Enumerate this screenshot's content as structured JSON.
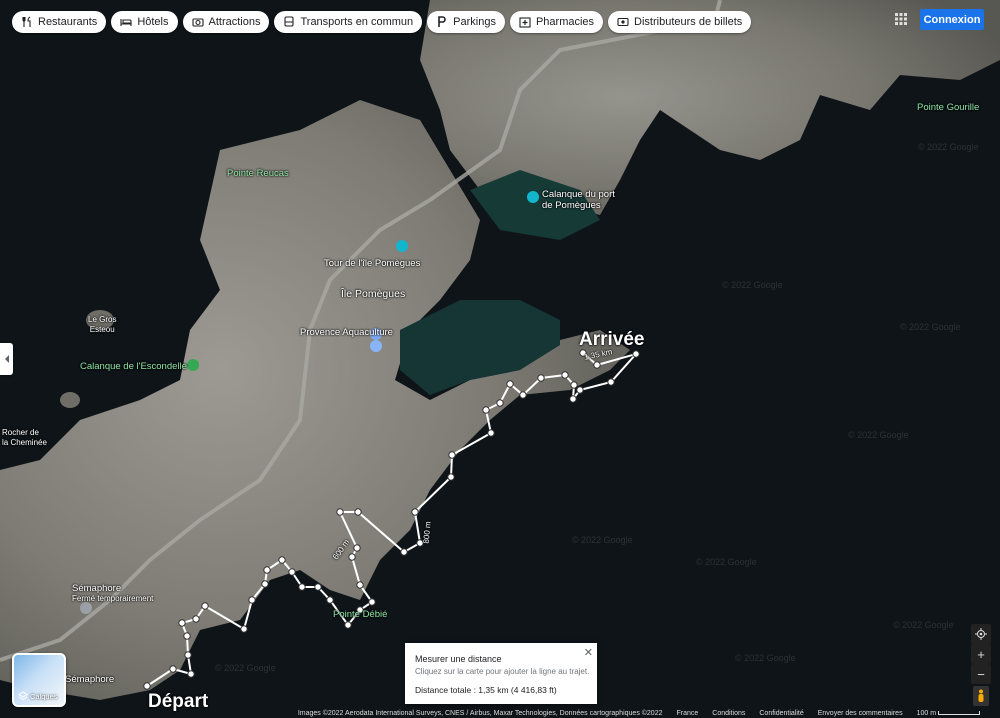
{
  "chips": [
    {
      "label": "Restaurants",
      "icon": "fork-knife-icon"
    },
    {
      "label": "Hôtels",
      "icon": "bed-icon"
    },
    {
      "label": "Attractions",
      "icon": "camera-icon"
    },
    {
      "label": "Transports en commun",
      "icon": "bus-icon"
    },
    {
      "label": "Parkings",
      "icon": "parking-icon"
    },
    {
      "label": "Pharmacies",
      "icon": "pharmacy-icon"
    },
    {
      "label": "Distributeurs de billets",
      "icon": "atm-icon"
    }
  ],
  "header": {
    "signin_label": "Connexion"
  },
  "labels": {
    "pointe_reucas": "Pointe Reucas",
    "calanque_port": "Calanque du port\nde Pomègues",
    "tour": "Tour de l'île Pomègues",
    "ile": "Île Pomègues",
    "aquaculture": "Provence Aquaculture",
    "gros_esteou": "Le Gros\nEsteou",
    "escondelle": "Calanque de l'Escondelle",
    "rocher": "Rocher de\nla Cheminée",
    "semaphore": "Sémaphore",
    "semaphore_sub": "Fermé temporairement",
    "semaphore2": "Sémaphore",
    "pointe_debie": "Pointe Débié",
    "pointe_gourille": "Pointe Gourille",
    "arrivee": "Arrivée",
    "depart": "Départ",
    "dist1": "1,35 km",
    "dist2": "600 m",
    "dist3": "800 m",
    "watermark": "© 2022 Google"
  },
  "measure": {
    "title": "Mesurer une distance",
    "hint": "Cliquez sur la carte pour ajouter la ligne au trajet.",
    "total": "Distance totale : 1,35 km (4 416,83 ft)"
  },
  "layers_label": "Calques",
  "footer": {
    "attribution": "Images ©2022 Aerodata International Surveys, CNES / Airbus, Maxar Technologies, Données cartographiques ©2022",
    "country": "France",
    "terms": "Conditions",
    "privacy": "Confidentialité",
    "feedback": "Envoyer des commentaires",
    "scale": "100 m"
  },
  "colors": {
    "accent": "#1a73e8",
    "sea": "#0e1418",
    "land": "#8a8880",
    "route": "#ffffff"
  }
}
